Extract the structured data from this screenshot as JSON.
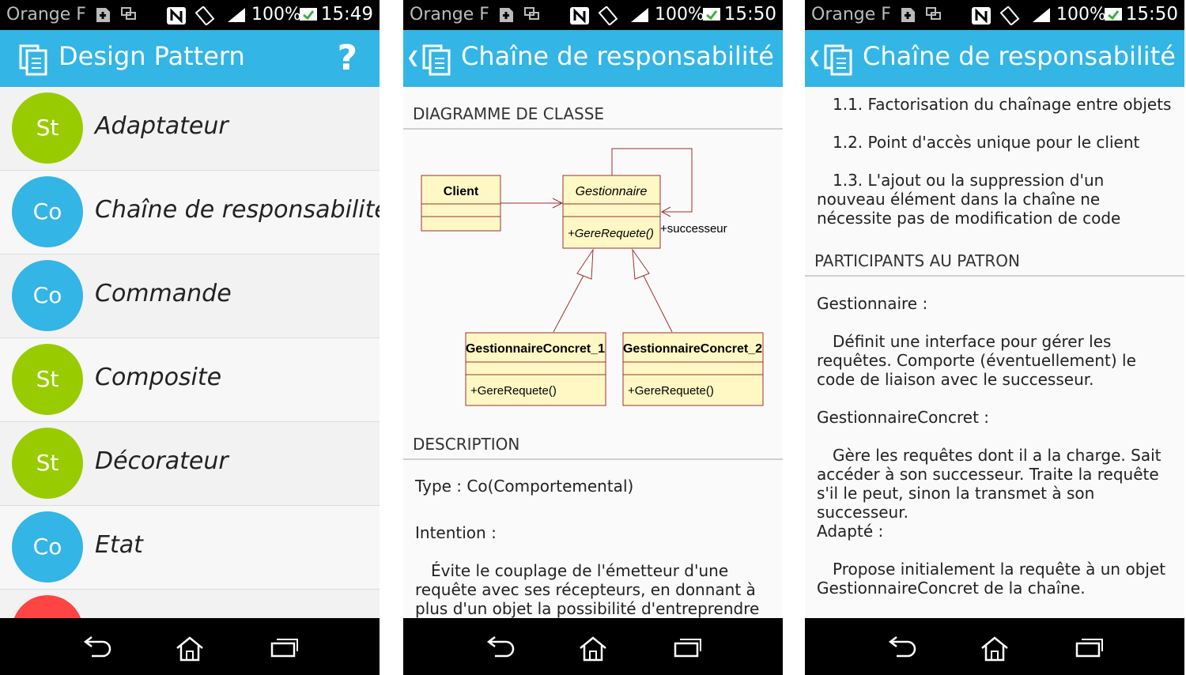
{
  "status": [
    {
      "carrier": "Orange F",
      "battery": "100%",
      "time": "15:49"
    },
    {
      "carrier": "Orange F",
      "battery": "100%",
      "time": "15:50"
    },
    {
      "carrier": "Orange F",
      "battery": "100%",
      "time": "15:50"
    }
  ],
  "screen1": {
    "title": "Design Pattern",
    "help_label": "?",
    "items": [
      {
        "badge": "St",
        "label": "Adaptateur",
        "color": "#99cc00"
      },
      {
        "badge": "Co",
        "label": "Chaîne de responsabilité",
        "color": "#33b5e5"
      },
      {
        "badge": "Co",
        "label": "Commande",
        "color": "#33b5e5"
      },
      {
        "badge": "St",
        "label": "Composite",
        "color": "#99cc00"
      },
      {
        "badge": "St",
        "label": "Décorateur",
        "color": "#99cc00"
      },
      {
        "badge": "Co",
        "label": "Etat",
        "color": "#33b5e5"
      },
      {
        "badge": "",
        "label": "",
        "color": "#ff4444"
      }
    ]
  },
  "screen2": {
    "title": "Chaîne de responsabilité",
    "section_diagram": "DIAGRAMME DE CLASSE",
    "diagram": {
      "client": "Client",
      "gestionnaire": "Gestionnaire",
      "gestionnaire_method": "+GereRequete()",
      "successeur": "+successeur",
      "concret1": "GestionnaireConcret_1",
      "concret1_method": "+GereRequete()",
      "concret2": "GestionnaireConcret_2",
      "concret2_method": "+GereRequete()"
    },
    "section_description": "DESCRIPTION",
    "type_line": "Type : Co(Comportemental)",
    "intention_label": "Intention :",
    "intention_text": "Évite le couplage de l'émetteur d'une requête avec ses récepteurs, en donnant à plus d'un objet la possibilité d'entreprendre la"
  },
  "screen3": {
    "title": "Chaîne de responsabilité",
    "bullets": [
      "1.1. Factorisation du chaînage entre objets",
      "1.2. Point d'accès unique pour le client",
      "1.3. L'ajout ou la suppression d'un nouveau élément dans la chaîne ne nécessite pas de modification de code"
    ],
    "section_participants": "PARTICIPANTS AU PATRON",
    "participants": [
      {
        "name": "Gestionnaire :",
        "desc": "Définit une interface pour gérer les requêtes. Comporte (éventuellement) le code de liaison avec le successeur."
      },
      {
        "name": "GestionnaireConcret :",
        "desc": "Gère les requêtes dont il a la charge. Sait accéder à son successeur. Traite la requête s'il le peut, sinon la transmet à son successeur."
      },
      {
        "name": "Adapté :",
        "desc": "Propose initialement la requête à un objet GestionnaireConcret de la chaîne."
      }
    ]
  }
}
